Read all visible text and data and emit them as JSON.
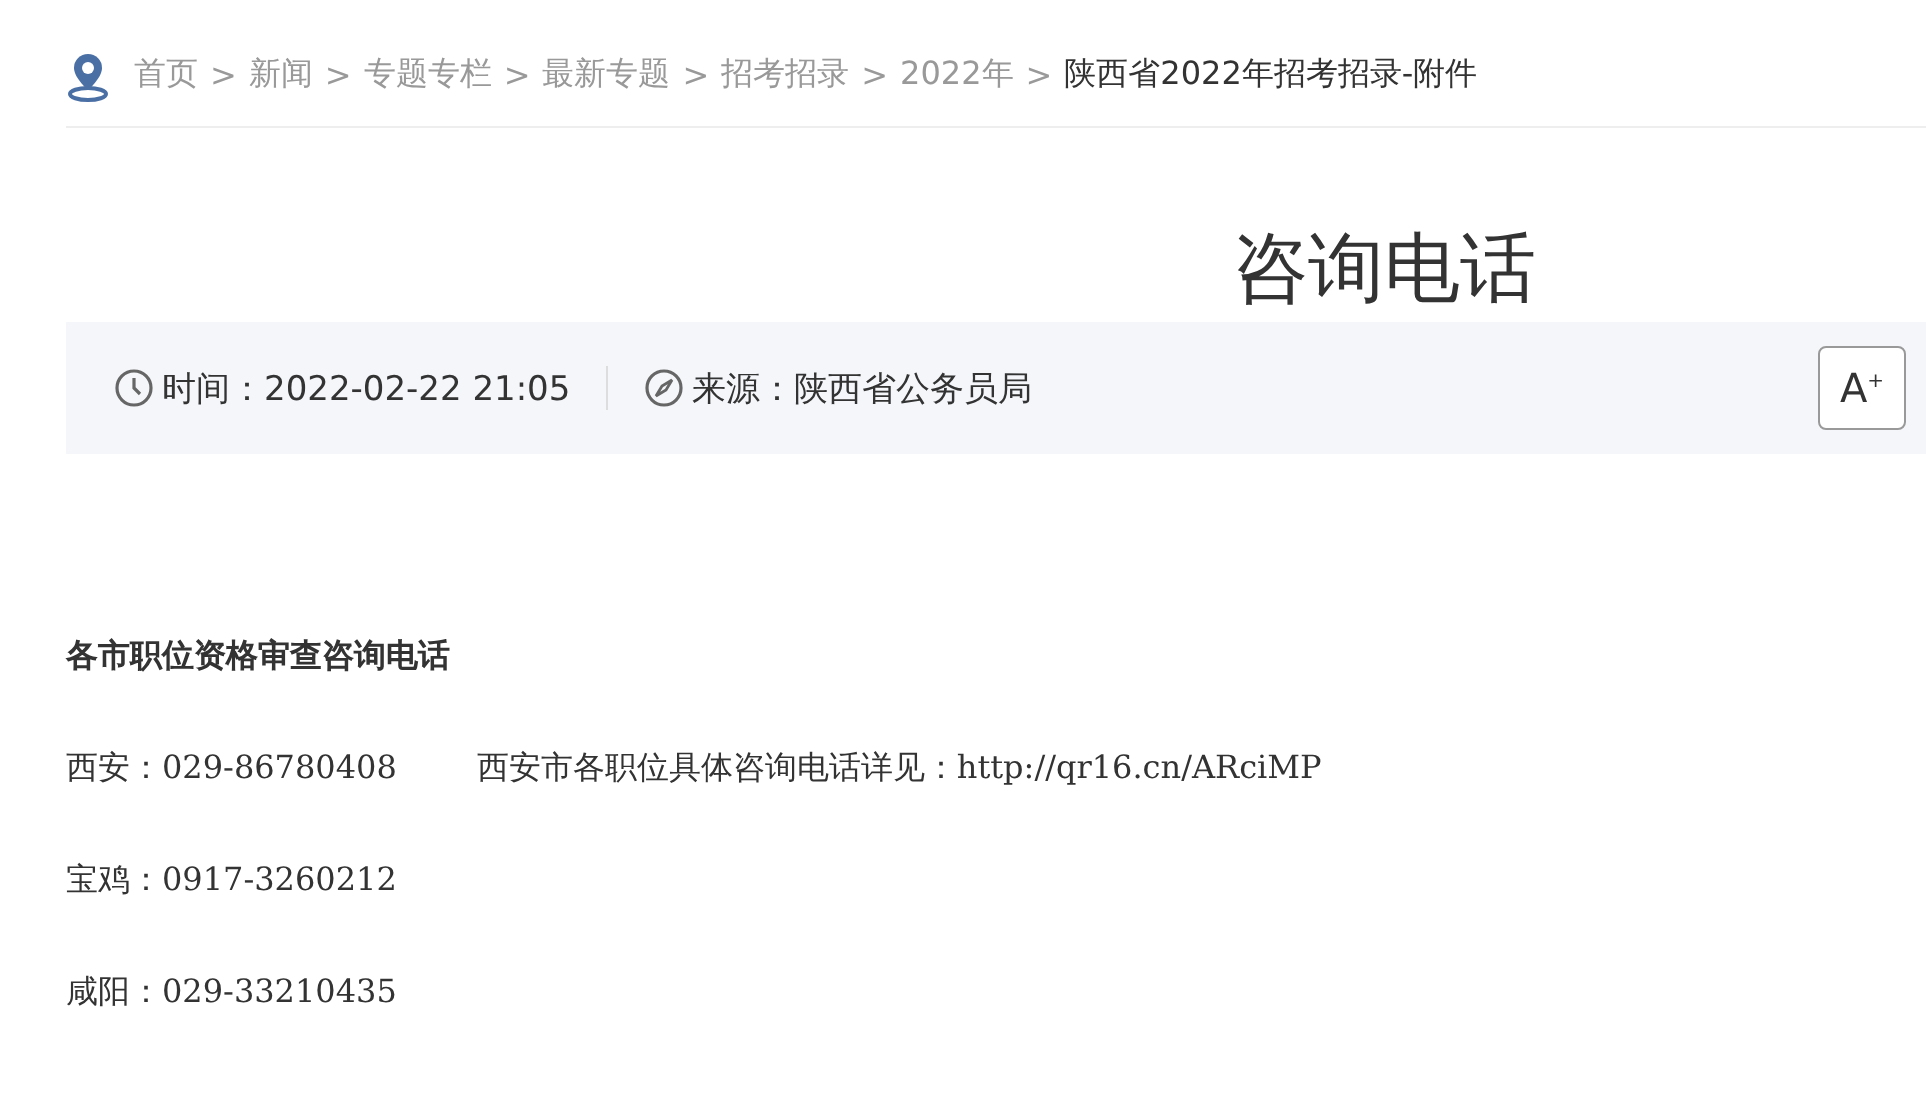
{
  "breadcrumb": {
    "separator": ">",
    "items": [
      {
        "label": "首页",
        "current": false
      },
      {
        "label": "新闻",
        "current": false
      },
      {
        "label": "专题专栏",
        "current": false
      },
      {
        "label": "最新专题",
        "current": false
      },
      {
        "label": "招考招录",
        "current": false
      },
      {
        "label": "2022年",
        "current": false
      },
      {
        "label": "陕西省2022年招考招录-附件",
        "current": true
      }
    ]
  },
  "article": {
    "title": "咨询电话",
    "time": "时间：2022-02-22 21:05",
    "source": "来源：陕西省公务员局",
    "font_button": {
      "label": "A",
      "mark": "+"
    },
    "paragraphs": [
      {
        "kind": "heading",
        "texts": [
          "各市职位资格审查咨询电话"
        ]
      },
      {
        "kind": "line",
        "texts": [
          "西安：029-86780408",
          "西安市各职位具体咨询电话详见：http://qr16.cn/ARciMP"
        ]
      },
      {
        "kind": "line",
        "texts": [
          "宝鸡：0917-3260212"
        ]
      },
      {
        "kind": "line",
        "texts": [
          "咸阳：029-33210435"
        ]
      }
    ]
  }
}
